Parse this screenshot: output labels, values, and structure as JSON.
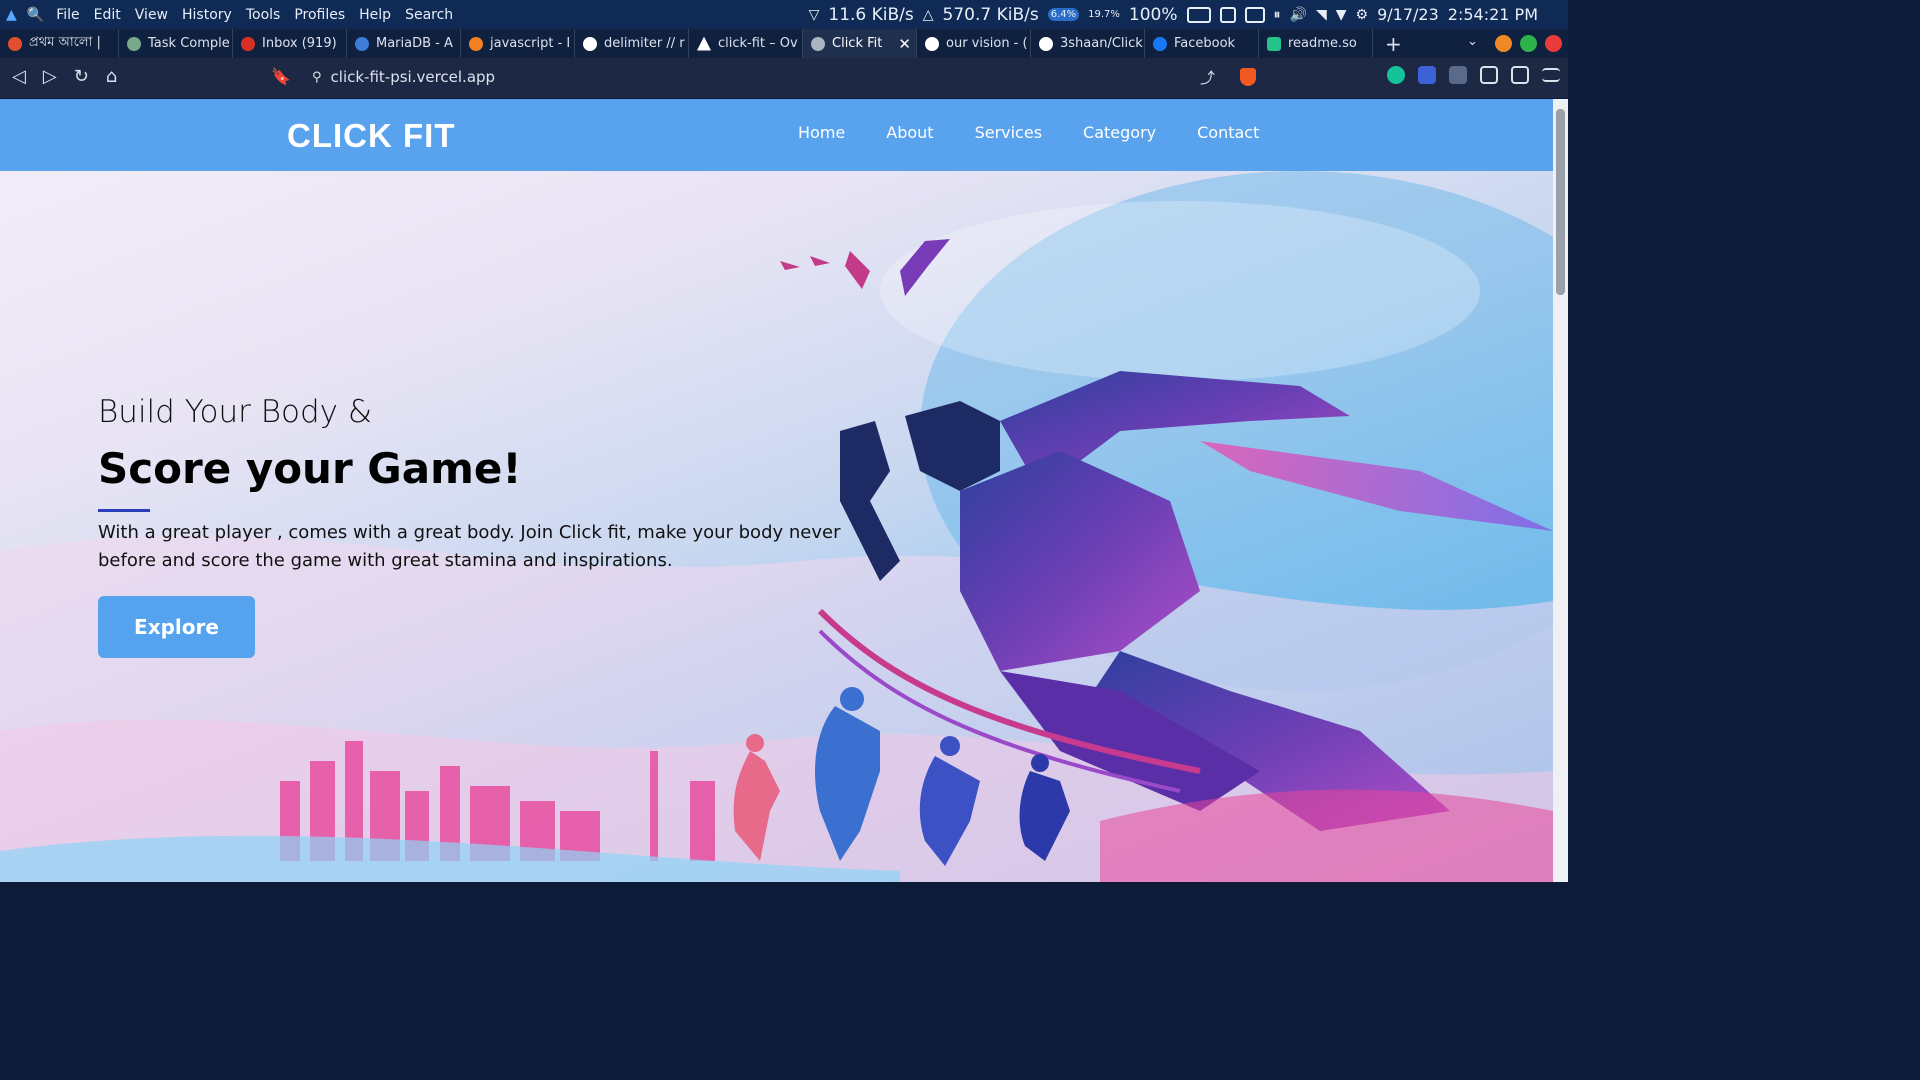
{
  "system_bar": {
    "menu": [
      "File",
      "Edit",
      "View",
      "History",
      "Tools",
      "Profiles",
      "Help",
      "Search"
    ],
    "net_down": "11.6 KiB/s",
    "net_up": "570.7 KiB/s",
    "cpu": "6.4%",
    "mem": "19.7%",
    "battery": "100%",
    "date": "9/17/23",
    "time": "2:54:21 PM"
  },
  "tabs": [
    {
      "title": "প্রথম আলো |",
      "icon": "news-icon",
      "color": "#e44d2e"
    },
    {
      "title": "Task Comple",
      "icon": "chatgpt-icon",
      "color": "#78a98d"
    },
    {
      "title": "Inbox (919)",
      "icon": "gmail-icon",
      "color": "#d93025"
    },
    {
      "title": "MariaDB - A",
      "icon": "mariadb-icon",
      "color": "#3c7dd6"
    },
    {
      "title": "javascript - I",
      "icon": "stackoverflow-icon",
      "color": "#f48024"
    },
    {
      "title": "delimiter // r",
      "icon": "google-icon",
      "color": "#ffffff"
    },
    {
      "title": "click-fit – Ov",
      "icon": "vercel-icon",
      "color": "#ffffff"
    },
    {
      "title": "Click Fit",
      "icon": "globe-icon",
      "color": "#aab3c2",
      "active": true
    },
    {
      "title": "our vision - (",
      "icon": "google-icon",
      "color": "#ffffff"
    },
    {
      "title": "3shaan/Click",
      "icon": "github-icon",
      "color": "#ffffff"
    },
    {
      "title": "Facebook",
      "icon": "facebook-icon",
      "color": "#1877f2"
    },
    {
      "title": "readme.so",
      "icon": "readme-icon",
      "color": "#25c38a"
    }
  ],
  "toolbar": {
    "url": "click-fit-psi.vercel.app"
  },
  "site": {
    "logo": "CLICK FIT",
    "nav": [
      "Home",
      "About",
      "Services",
      "Category",
      "Contact"
    ],
    "hero": {
      "line1": "Build Your Body &",
      "line2": "Score your Game!",
      "paragraph": "With a great player , comes with a great body. Join Click fit, make your body never before and score the game with great stamina and inspirations.",
      "button": "Explore"
    }
  },
  "colors": {
    "navbar": "#59a2ee",
    "button": "#55a2ee",
    "accent_line": "#2b3fbc"
  }
}
